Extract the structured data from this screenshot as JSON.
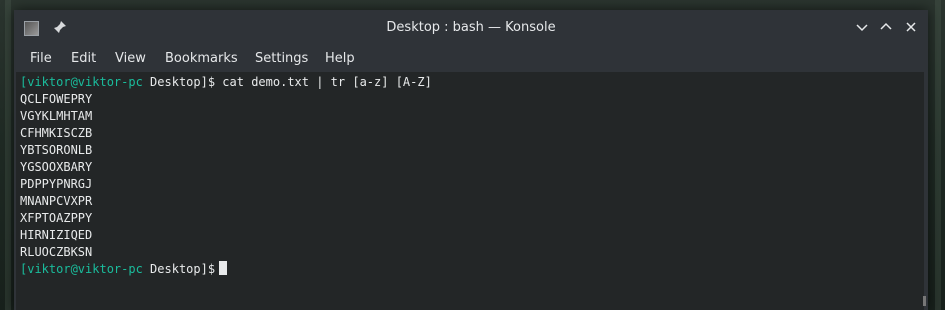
{
  "window": {
    "title": "Desktop : bash — Konsole",
    "controls": {
      "pin": "pin-icon",
      "minimize": "chevron-down-icon",
      "maximize": "chevron-up-icon",
      "close": "close-icon"
    }
  },
  "menu": [
    "File",
    "Edit",
    "View",
    "Bookmarks",
    "Settings",
    "Help"
  ],
  "terminal": {
    "command_prompt": {
      "user_host": "[viktor@viktor-pc",
      "dir": " Desktop]$",
      "command": " cat demo.txt | tr [a-z] [A-Z]"
    },
    "output": [
      "QCLFOWEPRY",
      "VGYKLMHTAM",
      "CFHMKISCZB",
      "YBTSORONLB",
      "YGSOOXBARY",
      "PDPPYPNRGJ",
      "MNANPCVXPR",
      "XFPTOAZPPY",
      "HIRNIZIQED",
      "RLUOCZBKSN"
    ],
    "current_prompt": {
      "user_host": "[viktor@viktor-pc",
      "dir": " Desktop]$"
    }
  },
  "colors": {
    "terminal_bg": "#232627",
    "prompt": "#1abc9c",
    "text": "#e8eaeb",
    "window": "#2f3338"
  }
}
